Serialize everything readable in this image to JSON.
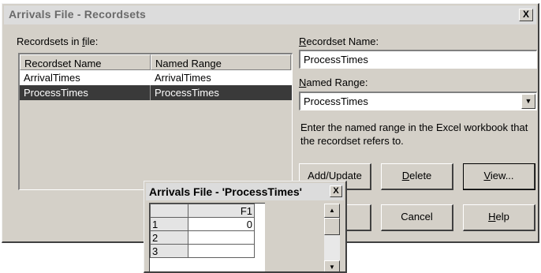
{
  "dialog": {
    "title": "Arrivals File - Recordsets",
    "close_label": "X"
  },
  "recordsets_label_pre": "Recordsets in ",
  "recordsets_label_key": "f",
  "recordsets_label_post": "ile:",
  "list": {
    "columns": [
      "Recordset Name",
      "Named Range"
    ],
    "rows": [
      {
        "name": "ArrivalTimes",
        "range": "ArrivalTimes",
        "selected": false
      },
      {
        "name": "ProcessTimes",
        "range": "ProcessTimes",
        "selected": true
      }
    ]
  },
  "recordset_name": {
    "label_key": "R",
    "label_rest": "ecordset Name:",
    "value": "ProcessTimes"
  },
  "named_range": {
    "label_key": "N",
    "label_rest": "amed Range:",
    "value": "ProcessTimes"
  },
  "help_text": "Enter the named range in the Excel workbook that the recordset refers to.",
  "buttons": {
    "add_update": "Add/Update",
    "delete_key": "D",
    "delete_rest": "elete",
    "view_key": "V",
    "view_rest": "iew...",
    "cancel": "Cancel",
    "help_key": "H",
    "help_rest": "elp"
  },
  "preview": {
    "title": "Arrivals File - 'ProcessTimes'",
    "close_label": "X",
    "column_header": "F1",
    "row_numbers": [
      "1",
      "2",
      "3"
    ],
    "values": [
      "0",
      "",
      ""
    ]
  }
}
